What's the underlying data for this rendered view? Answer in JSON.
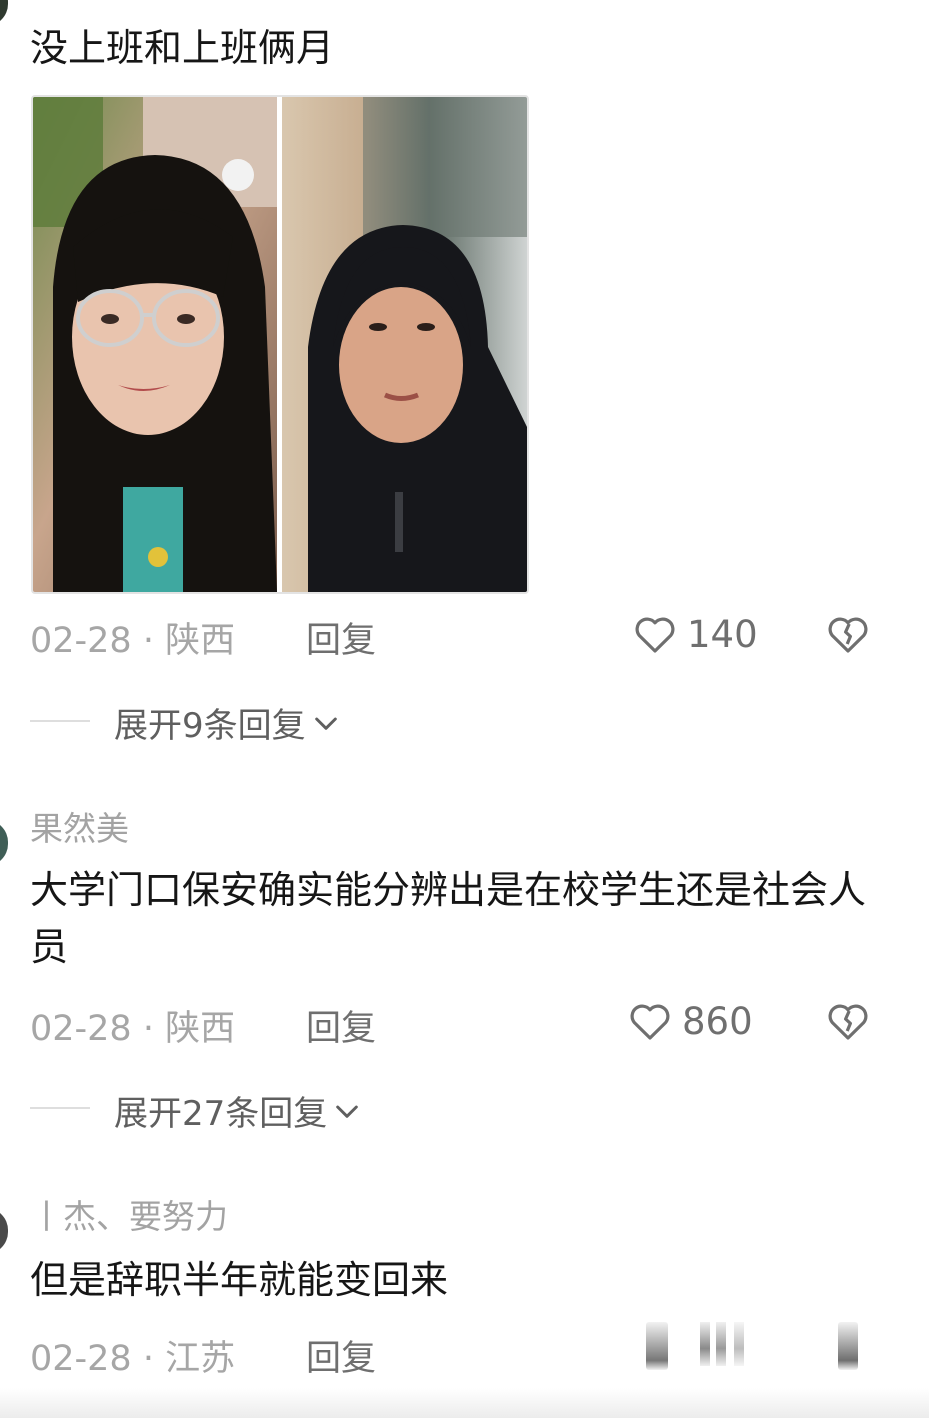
{
  "comments": [
    {
      "text": "没上班和上班俩月",
      "date": "02-28",
      "location": "陕西",
      "reply_label": "回复",
      "likes": "140",
      "expand_label": "展开9条回复"
    },
    {
      "username": "果然美",
      "text": "大学门口保安确实能分辨出是在校学生还是社会人员",
      "date": "02-28",
      "location": "陕西",
      "reply_label": "回复",
      "likes": "860",
      "expand_label": "展开27条回复"
    },
    {
      "username": "丨杰、要努力",
      "text": "但是辞职半年就能变回来",
      "date": "02-28",
      "location": "江苏",
      "reply_label": "回复"
    }
  ],
  "separator": " · ",
  "icons": {
    "like": "heart-outline-icon",
    "dislike": "broken-heart-icon",
    "expand": "chevron-down-icon"
  },
  "colors": {
    "text": "#161616",
    "muted": "#a6a6a6",
    "link": "#6f6f6f"
  }
}
